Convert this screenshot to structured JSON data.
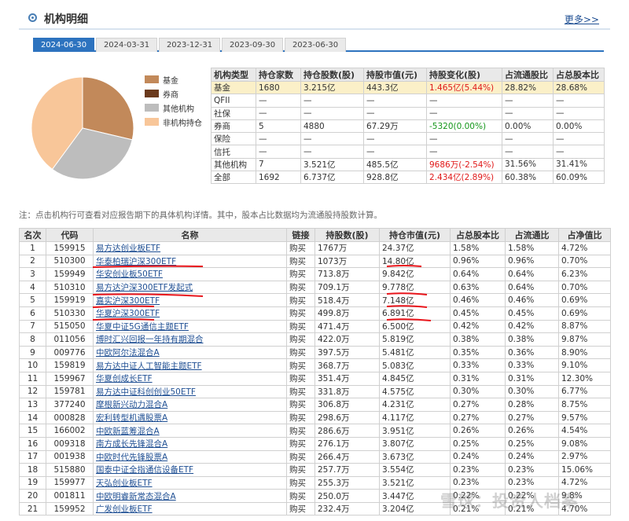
{
  "header": {
    "title": "机构明细",
    "more": "更多>>"
  },
  "tabs": [
    "2024-06-30",
    "2024-03-31",
    "2023-12-31",
    "2023-09-30",
    "2023-06-30"
  ],
  "legend": [
    {
      "label": "基金",
      "color": "#c2895a"
    },
    {
      "label": "券商",
      "color": "#6b3a1c"
    },
    {
      "label": "其他机构",
      "color": "#bdbdbd"
    },
    {
      "label": "非机构持仓",
      "color": "#f8c699"
    }
  ],
  "pie": [
    {
      "label": "基金",
      "value": 28.68,
      "color": "#c2895a"
    },
    {
      "label": "券商",
      "value": 0.0,
      "color": "#6b3a1c"
    },
    {
      "label": "其他机构",
      "value": 31.41,
      "color": "#bdbdbd"
    },
    {
      "label": "非机构持仓",
      "value": 39.91,
      "color": "#f8c699"
    }
  ],
  "summary": {
    "headers": [
      "机构类型",
      "持仓家数",
      "持仓股数(股)",
      "持股市值(元)",
      "持股变化(股)",
      "占流通股比",
      "占总股本比"
    ],
    "rows": [
      [
        "基金",
        "1680",
        "3.215亿",
        "443.3亿",
        "1.465亿(5.44%)",
        "28.82%",
        "28.68%"
      ],
      [
        "QFII",
        "—",
        "—",
        "—",
        "—",
        "—",
        "—"
      ],
      [
        "社保",
        "—",
        "—",
        "—",
        "—",
        "—",
        "—"
      ],
      [
        "券商",
        "5",
        "4880",
        "67.29万",
        "-5320(0.00%)",
        "0.00%",
        "0.00%"
      ],
      [
        "保险",
        "—",
        "—",
        "—",
        "—",
        "—",
        "—"
      ],
      [
        "信托",
        "—",
        "—",
        "—",
        "—",
        "—",
        "—"
      ],
      [
        "其他机构",
        "7",
        "3.521亿",
        "485.5亿",
        "9686万(-2.54%)",
        "31.56%",
        "31.41%"
      ],
      [
        "全部",
        "1692",
        "6.737亿",
        "928.8亿",
        "2.434亿(2.89%)",
        "60.38%",
        "60.09%"
      ]
    ]
  },
  "note": "注：点击机构行可查看对应报告期下的具体机构详情。其中，股本占比数据均为流通股持股数计算。",
  "funds": {
    "headers": [
      "名次",
      "代码",
      "名称",
      "链接",
      "持股数(股)",
      "持仓市值(元)",
      "占总股本比",
      "占流通比",
      "占净值比"
    ],
    "link_label": "购买",
    "rows": [
      [
        "1",
        "159915",
        "易方达创业板ETF",
        "1767万",
        "24.37亿",
        "1.58%",
        "1.58%",
        "4.72%"
      ],
      [
        "2",
        "510300",
        "华泰柏瑞沪深300ETF",
        "1073万",
        "14.80亿",
        "0.96%",
        "0.96%",
        "0.70%"
      ],
      [
        "3",
        "159949",
        "华安创业板50ETF",
        "713.8万",
        "9.842亿",
        "0.64%",
        "0.64%",
        "6.23%"
      ],
      [
        "4",
        "510310",
        "易方达沪深300ETF发起式",
        "709.1万",
        "9.778亿",
        "0.63%",
        "0.64%",
        "0.70%"
      ],
      [
        "5",
        "159919",
        "嘉实沪深300ETF",
        "518.4万",
        "7.148亿",
        "0.46%",
        "0.46%",
        "0.69%"
      ],
      [
        "6",
        "510330",
        "华夏沪深300ETF",
        "499.8万",
        "6.891亿",
        "0.45%",
        "0.45%",
        "0.69%"
      ],
      [
        "7",
        "515050",
        "华夏中证5G通信主题ETF",
        "471.4万",
        "6.500亿",
        "0.42%",
        "0.42%",
        "8.87%"
      ],
      [
        "8",
        "011056",
        "博时汇兴回报一年持有期混合",
        "422.0万",
        "5.819亿",
        "0.38%",
        "0.38%",
        "9.87%"
      ],
      [
        "9",
        "009776",
        "中欧阿尔法混合A",
        "397.5万",
        "5.481亿",
        "0.35%",
        "0.36%",
        "8.90%"
      ],
      [
        "10",
        "159819",
        "易方达中证人工智能主题ETF",
        "368.7万",
        "5.083亿",
        "0.33%",
        "0.33%",
        "9.10%"
      ],
      [
        "11",
        "159967",
        "华夏创成长ETF",
        "351.4万",
        "4.845亿",
        "0.31%",
        "0.31%",
        "12.30%"
      ],
      [
        "12",
        "159781",
        "易方达中证科创创业50ETF",
        "331.8万",
        "4.575亿",
        "0.30%",
        "0.30%",
        "6.77%"
      ],
      [
        "13",
        "377240",
        "摩根新兴动力混合A",
        "306.8万",
        "4.231亿",
        "0.27%",
        "0.28%",
        "8.75%"
      ],
      [
        "14",
        "000828",
        "宏利转型机遇股票A",
        "298.6万",
        "4.117亿",
        "0.27%",
        "0.27%",
        "9.57%"
      ],
      [
        "15",
        "166002",
        "中欧新蓝筹混合A",
        "286.6万",
        "3.951亿",
        "0.26%",
        "0.26%",
        "4.54%"
      ],
      [
        "16",
        "009318",
        "南方成长先锋混合A",
        "276.1万",
        "3.807亿",
        "0.25%",
        "0.25%",
        "9.08%"
      ],
      [
        "17",
        "001938",
        "中欧时代先锋股票A",
        "266.4万",
        "3.673亿",
        "0.24%",
        "0.24%",
        "2.97%"
      ],
      [
        "18",
        "515880",
        "国泰中证全指通信设备ETF",
        "257.7万",
        "3.554亿",
        "0.23%",
        "0.23%",
        "15.06%"
      ],
      [
        "19",
        "159977",
        "天弘创业板ETF",
        "255.3万",
        "3.521亿",
        "0.23%",
        "0.23%",
        "4.72%"
      ],
      [
        "20",
        "001811",
        "中欧明睿新常态混合A",
        "250.0万",
        "3.447亿",
        "0.22%",
        "0.22%",
        "9.8%"
      ],
      [
        "21",
        "159952",
        "广发创业板ETF",
        "232.4万",
        "3.204亿",
        "0.21%",
        "0.21%",
        "4.70%"
      ]
    ]
  },
  "watermark": "雪球：投资人档案"
}
